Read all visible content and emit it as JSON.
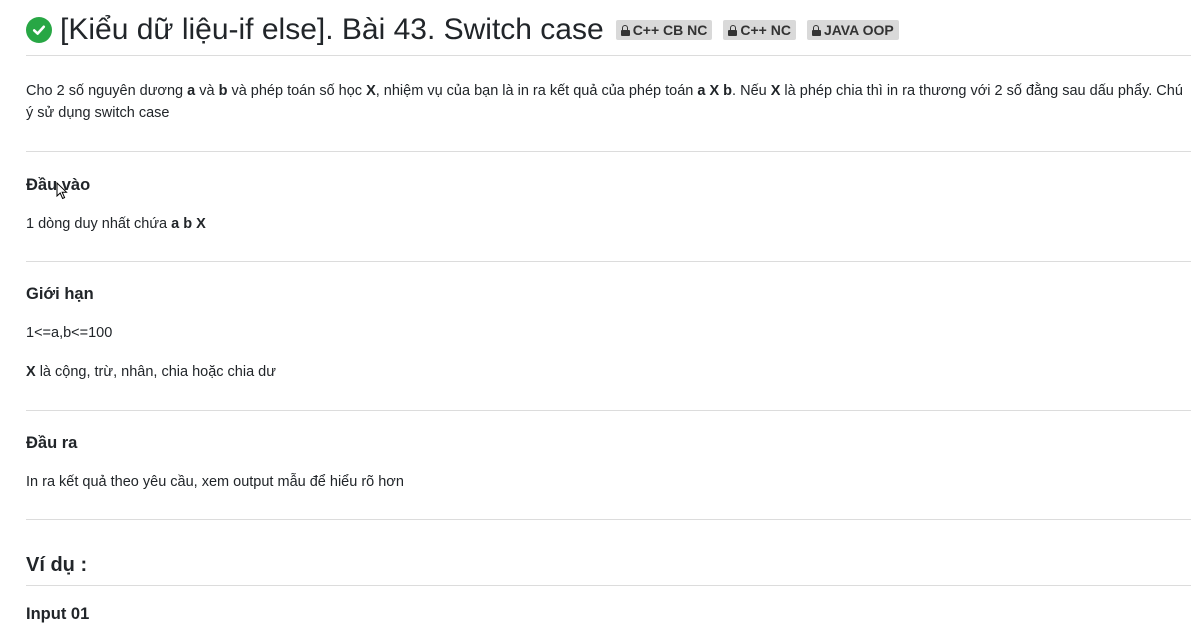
{
  "title": {
    "text": "[Kiểu dữ liệu-if else]. Bài 43. Switch case",
    "status_color": "#28a745",
    "status_icon": "check-circle-icon"
  },
  "tags": [
    {
      "label": "C++ CB NC",
      "icon": "lock-icon"
    },
    {
      "label": "C++ NC",
      "icon": "lock-icon"
    },
    {
      "label": "JAVA OOP",
      "icon": "lock-icon"
    }
  ],
  "description": {
    "p1": "Cho 2 số nguyên dương ",
    "b1": "a",
    "p2": " và ",
    "b2": "b",
    "p3": " và phép toán số học ",
    "b3": "X",
    "p4": ", nhiệm vụ của bạn là in ra kết quả của phép toán ",
    "b4": "a X b",
    "p5": ". Nếu ",
    "b5": "X",
    "p6": " là phép chia thì in ra thương với 2 số đằng sau dấu phẩy. Chú ý sử dụng switch case"
  },
  "input_section": {
    "heading": "Đầu vào",
    "text": "1 dòng duy nhất chứa ",
    "bold": "a b X"
  },
  "limits_section": {
    "heading": "Giới hạn",
    "line1": "1<=a,b<=100",
    "line2_bold": "X",
    "line2": " là cộng, trừ, nhân, chia hoặc chia dư"
  },
  "output_section": {
    "heading": "Đầu ra",
    "text": "In ra kết quả theo yêu cầu, xem output mẫu để hiểu rõ hơn"
  },
  "examples": {
    "heading": "Ví dụ :",
    "input_heading": "Input 01"
  }
}
